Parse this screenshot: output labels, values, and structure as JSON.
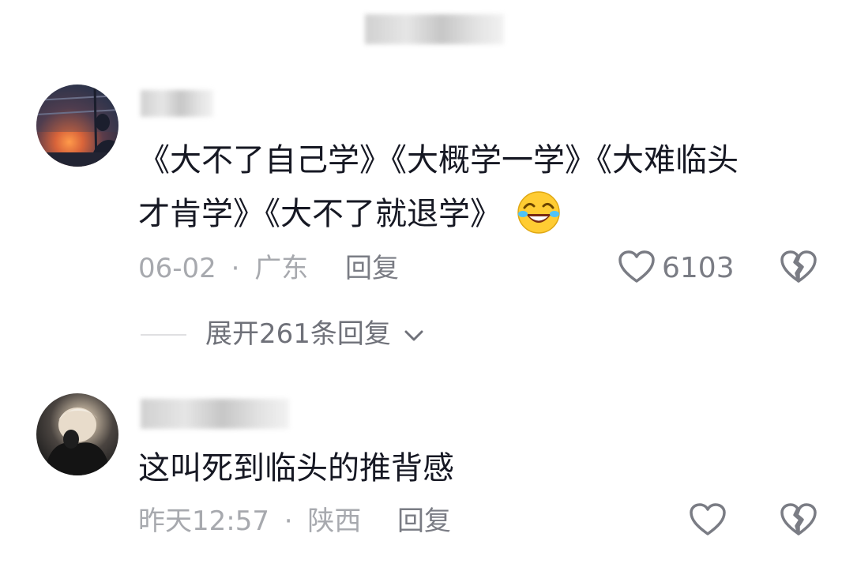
{
  "comments": [
    {
      "text_line1": "《大不了自己学》《大概学一学》《大难临头",
      "text_line2": "才肯学》《大不了就退学》",
      "emoji": "laughing-crying-emoji",
      "date": "06-02",
      "separator": "·",
      "location": "广东",
      "reply_label": "回复",
      "like_count": "6103",
      "expand_replies": "展开261条回复"
    },
    {
      "text_line1": "这叫死到临头的推背感",
      "date": "昨天12:57",
      "separator": "·",
      "location": "陕西",
      "reply_label": "回复"
    }
  ],
  "icons": {
    "like": "heart-outline-icon",
    "dislike": "broken-heart-icon",
    "expand": "chevron-down-icon"
  },
  "colors": {
    "text_primary": "#161823",
    "text_meta": "#a7a9ae",
    "text_action": "#7a7c84",
    "icon": "#7a7c84"
  }
}
